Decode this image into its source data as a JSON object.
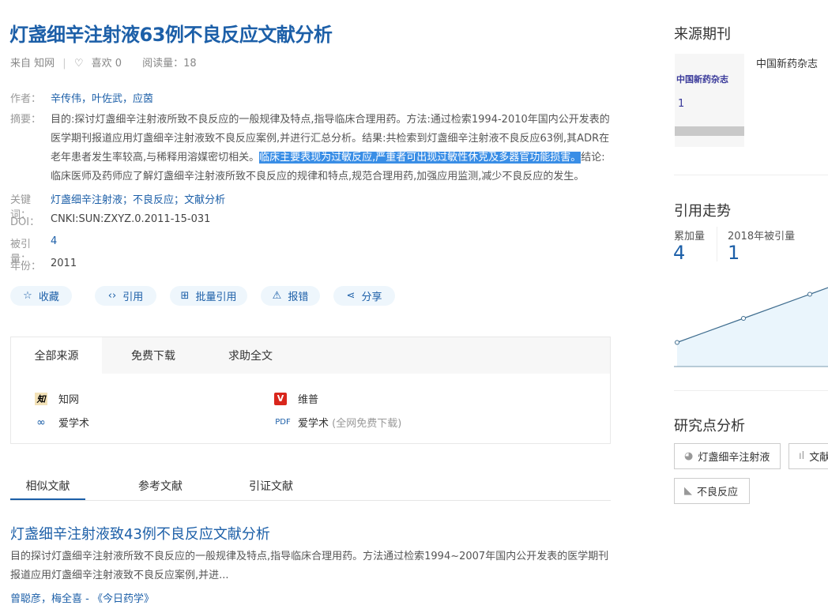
{
  "article": {
    "title": "灯盏细辛注射液63例不良反应文献分析",
    "source": "来自 知网",
    "likes_label": "喜欢 0",
    "reads_label": "阅读量：18",
    "authors_label": "作者：",
    "authors": "辛传伟，叶佐武，应茵",
    "abstract_label": "摘要：",
    "abstract_before": "目的:探讨灯盏细辛注射液所致不良反应的一般规律及特点,指导临床合理用药。方法:通过检索1994-2010年国内公开发表的医学期刊报道应用灯盏细辛注射液致不良反应案例,并进行汇总分析。结果:共检索到灯盏细辛注射液不良反应63例,其ADR在老年患者发生率较高,与稀释用溶媒密切相关。",
    "abstract_highlight": "临床主要表现为过敏反应,严重者可出现过敏性休克及多器官功能损害。",
    "abstract_after": "结论:临床医师及药师应了解灯盏细辛注射液所致不良反应的规律和特点,规范合理用药,加强应用监测,减少不良反应的发生。",
    "keywords_label": "关键词：",
    "keywords": [
      "灯盏细辛注射液",
      "不良反应",
      "文献分析"
    ],
    "doi_label": "DOI：",
    "doi": "CNKI:SUN:ZXYZ.0.2011-15-031",
    "cited_label": "被引量：",
    "cited": "4",
    "year_label": "年份：",
    "year": "2011"
  },
  "actions": {
    "favorite": "收藏",
    "cite": "引用",
    "batch_cite": "批量引用",
    "report": "报错",
    "share": "分享"
  },
  "sources": {
    "tabs": [
      "全部来源",
      "免费下载",
      "求助全文"
    ],
    "items": [
      {
        "name": "知网",
        "icon": "知"
      },
      {
        "name": "维普",
        "icon": "V"
      },
      {
        "name": "爱学术",
        "icon": "link"
      },
      {
        "name": "爱学术",
        "icon": "PDF",
        "note": "(全网免费下载)"
      }
    ]
  },
  "lower_tabs": [
    "相似文献",
    "参考文献",
    "引证文献"
  ],
  "similar": [
    {
      "title": "灯盏细辛注射液致43例不良反应文献分析",
      "snippet": "目的探讨灯盏细辛注射液所致不良反应的一般规律及特点,指导临床合理用药。方法通过检索1994~2007年国内公开发表的医学期刊报道应用灯盏细辛注射液致不良反应案例,并进...",
      "authors": "曾聪彦，梅全喜 - 《今日药学》"
    }
  ],
  "sidebar": {
    "journal_heading": "来源期刊",
    "journal_name": "中国新药杂志",
    "trend_heading": "引用走势",
    "total_label": "累加量",
    "total": "4",
    "year_label": "2018年被引量",
    "year_value": "1",
    "trend_values": [
      1,
      2,
      3,
      4
    ],
    "research_heading": "研究点分析",
    "research_tags": [
      "灯盏细辛注射液",
      "文献",
      "不良反应"
    ]
  },
  "colors": {
    "link": "#1c5fa8",
    "highlight": "#3a8ee6",
    "button_bg": "#eef6fc"
  }
}
